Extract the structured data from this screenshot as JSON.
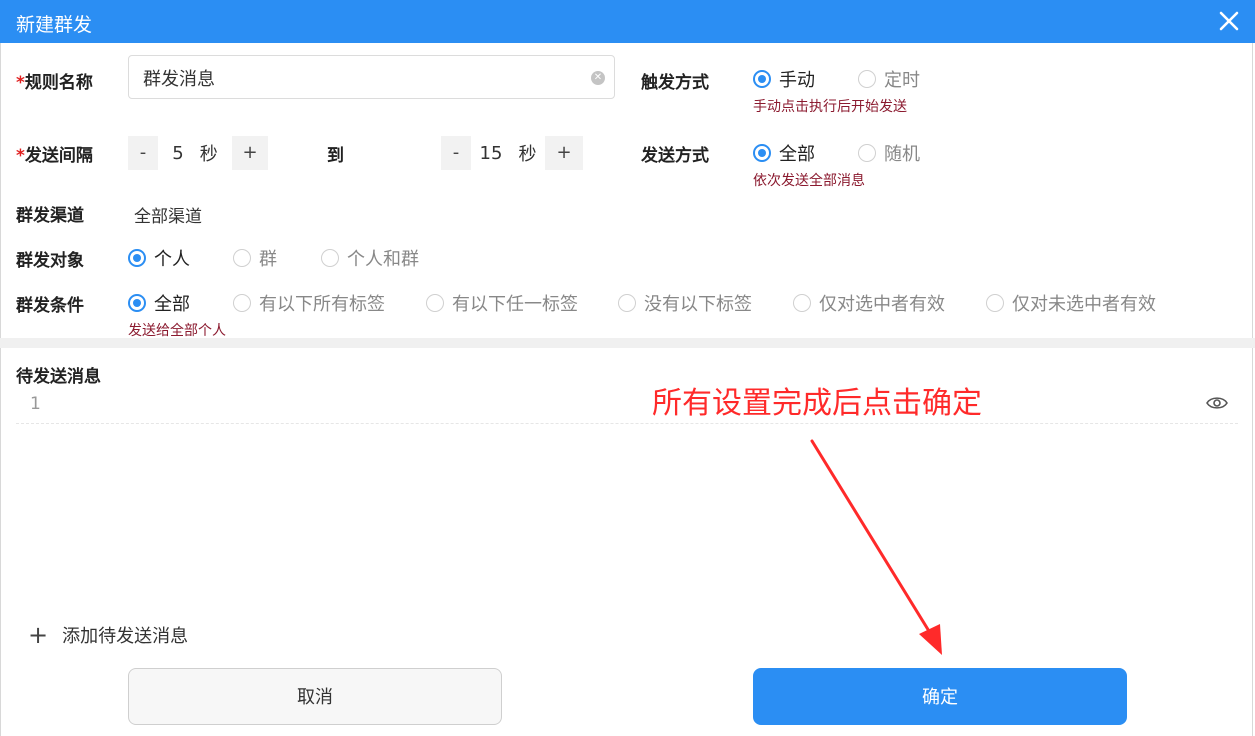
{
  "dialog": {
    "title": "新建群发"
  },
  "colors": {
    "titlebar": "#2b8ef3",
    "primary": "#2b8ef3",
    "hint": "#8b1a2f",
    "annotation": "#ff2a2a"
  },
  "rule_name": {
    "required_mark": "*",
    "label": "规则名称",
    "value": "群发消息"
  },
  "trigger": {
    "label": "触发方式",
    "options": [
      "手动",
      "定时"
    ],
    "selected": "手动",
    "hint": "手动点击执行后开始发送"
  },
  "interval": {
    "required_mark": "*",
    "label": "发送间隔",
    "min": {
      "value": "5",
      "unit": "秒"
    },
    "to_label": "到",
    "max": {
      "value": "15",
      "unit": "秒"
    },
    "minus": "-",
    "plus": "+"
  },
  "send_mode": {
    "label": "发送方式",
    "options": [
      "全部",
      "随机"
    ],
    "selected": "全部",
    "hint": "依次发送全部消息"
  },
  "channel": {
    "label": "群发渠道",
    "value": "全部渠道"
  },
  "target": {
    "label": "群发对象",
    "options": [
      "个人",
      "群",
      "个人和群"
    ],
    "selected": "个人"
  },
  "condition": {
    "label": "群发条件",
    "options": [
      "全部",
      "有以下所有标签",
      "有以下任一标签",
      "没有以下标签",
      "仅对选中者有效",
      "仅对未选中者有效"
    ],
    "selected": "全部",
    "hint": "发送给全部个人"
  },
  "pending": {
    "label": "待发送消息",
    "items": [
      {
        "index": "1"
      }
    ],
    "preview_icon": "eye-icon"
  },
  "annotation": {
    "text": "所有设置完成后点击确定"
  },
  "add_message": {
    "label": "添加待发送消息"
  },
  "footer": {
    "cancel": "取消",
    "confirm": "确定"
  }
}
